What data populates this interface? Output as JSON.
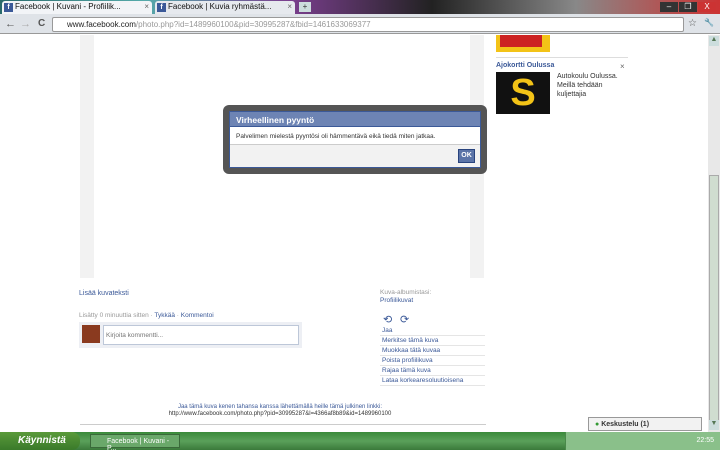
{
  "browser": {
    "tabs": [
      {
        "label": "Facebook | Kuvani - Profiilik...",
        "close": "×"
      },
      {
        "label": "Facebook | Kuvia ryhmästä...",
        "close": "×"
      }
    ],
    "new_tab": "+",
    "window_controls": [
      "–",
      "❐",
      "X"
    ],
    "url_domain": "www.facebook.com",
    "url_path": "/photo.php?id=1489960100&pid=30995287&fbid=1461633069377",
    "nav": {
      "back": "←",
      "forward": "→",
      "reload": "C",
      "star": "☆",
      "wrench": "🔧"
    }
  },
  "ad": {
    "title": "Ajokortti Oulussa",
    "close": "×",
    "logo": "S",
    "text": "Autokoulu Oulussa. Meillä tehdään kuljettajia"
  },
  "dialog": {
    "title": "Virheellinen pyyntö",
    "message": "Palvelimen mielestä pyyntösi oli hämmentävä eikä tiedä miten jatkaa.",
    "ok": "OK"
  },
  "photo": {
    "add_caption": "Lisää kuvateksti",
    "added": "Lisätty 0 minuuttia sitten",
    "sep": " · ",
    "like": "Tykkää",
    "comment": "Kommentoi",
    "comment_placeholder": "Kirjoita kommentti...",
    "album_label": "Kuva-albumistasi:",
    "album_name": "Profiilikuvat",
    "actions": [
      "Jaa",
      "Merkitse tämä kuva",
      "Muokkaa tätä kuvaa",
      "Poista profiilikuva",
      "Rajaa tämä kuva",
      "Lataa korkearesoluutioisena"
    ],
    "share_text": "Jaa tämä kuva kenen tahansa kanssa lähettämällä heille tämä julkinen linkki:",
    "share_link": "http://www.facebook.com/photo.php?pid=30995287&l=4366af8b89&id=1489960100"
  },
  "chat": {
    "label": "Keskustelu (1)"
  },
  "taskbar": {
    "start": "Käynnistä",
    "item": "Facebook | Kuvani - P...",
    "clock": "22:55"
  }
}
